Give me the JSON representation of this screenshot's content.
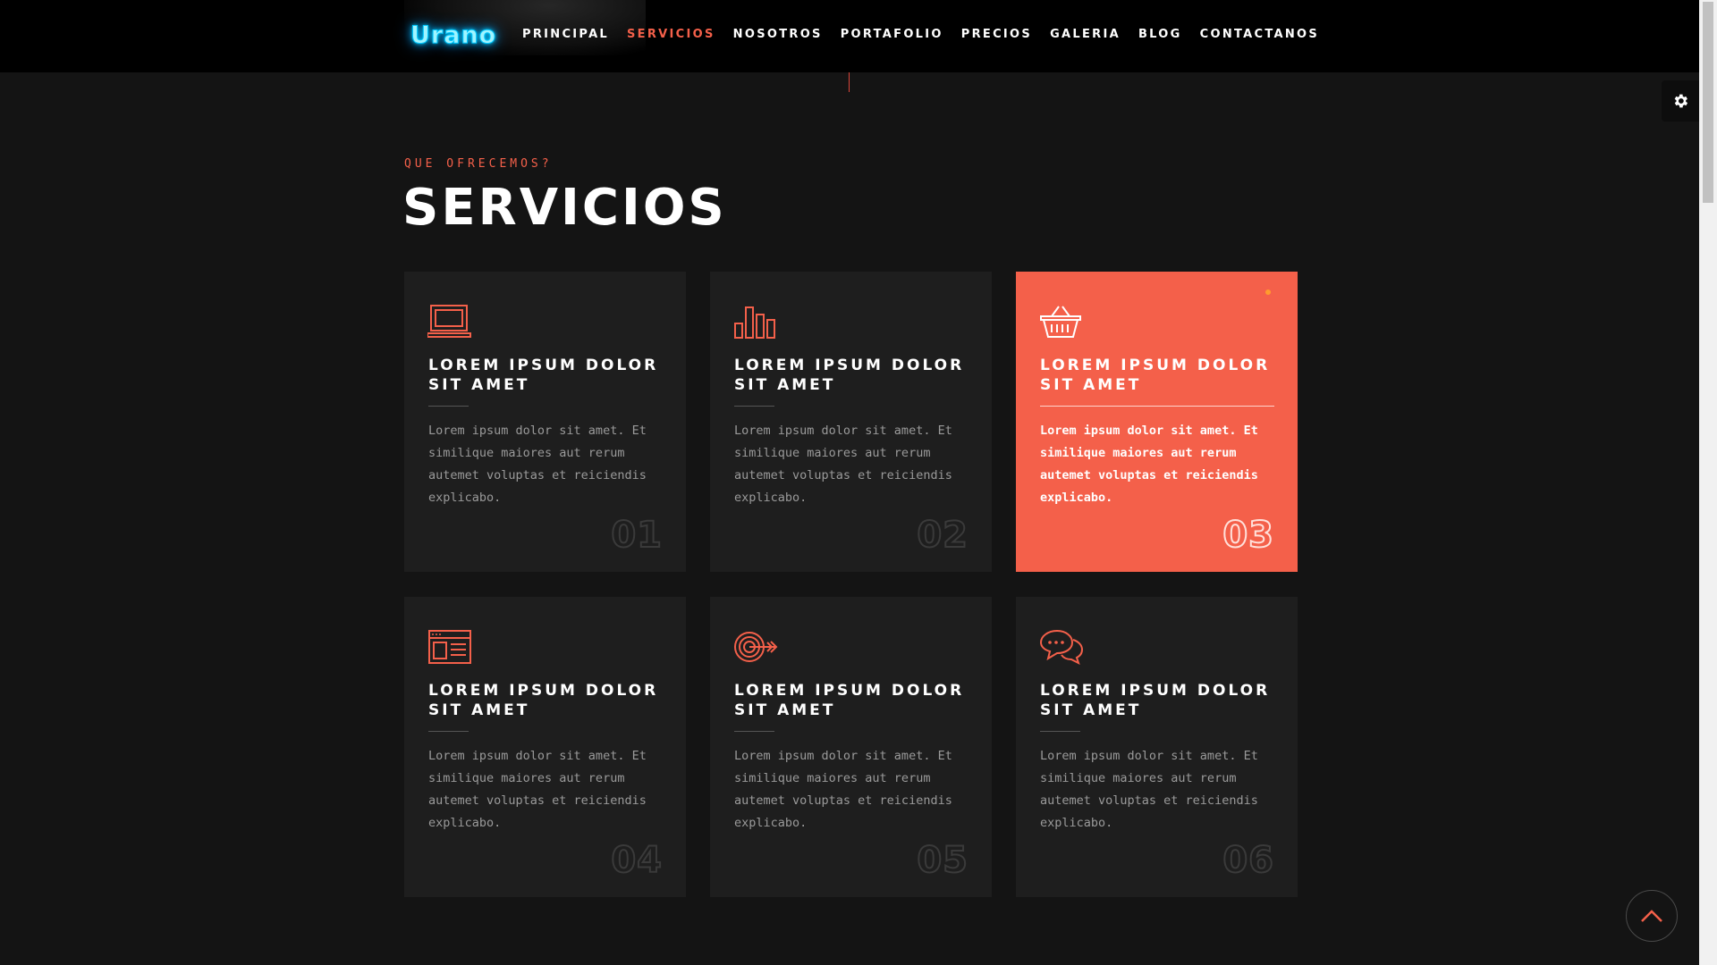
{
  "nav": {
    "logo": "Urano",
    "items": [
      {
        "label": "PRINCIPAL",
        "active": false
      },
      {
        "label": "SERVICIOS",
        "active": true
      },
      {
        "label": "NOSOTROS",
        "active": false
      },
      {
        "label": "PORTAFOLIO",
        "active": false
      },
      {
        "label": "PRECIOS",
        "active": false
      },
      {
        "label": "GALERIA",
        "active": false
      },
      {
        "label": "BLOG",
        "active": false
      },
      {
        "label": "CONTACTANOS",
        "active": false
      }
    ]
  },
  "section": {
    "subtitle": "QUE OFRECEMOS?",
    "title": "SERVICIOS"
  },
  "cards": [
    {
      "icon": "laptop-icon",
      "title": "LOREM IPSUM DOLOR SIT AMET",
      "text": "Lorem ipsum dolor sit amet. Et similique maiores aut rerum autemet voluptas et reiciendis explicabo.",
      "number": "01",
      "active": false
    },
    {
      "icon": "bar-chart-icon",
      "title": "LOREM IPSUM DOLOR SIT AMET",
      "text": "Lorem ipsum dolor sit amet. Et similique maiores aut rerum autemet voluptas et reiciendis explicabo.",
      "number": "02",
      "active": false
    },
    {
      "icon": "basket-icon",
      "title": "LOREM IPSUM DOLOR SIT AMET",
      "text": "Lorem ipsum dolor sit amet. Et similique maiores aut rerum autemet voluptas et reiciendis explicabo.",
      "number": "03",
      "active": true
    },
    {
      "icon": "browser-window-icon",
      "title": "LOREM IPSUM DOLOR SIT AMET",
      "text": "Lorem ipsum dolor sit amet. Et similique maiores aut rerum autemet voluptas et reiciendis explicabo.",
      "number": "04",
      "active": false
    },
    {
      "icon": "target-icon",
      "title": "LOREM IPSUM DOLOR SIT AMET",
      "text": "Lorem ipsum dolor sit amet. Et similique maiores aut rerum autemet voluptas et reiciendis explicabo.",
      "number": "05",
      "active": false
    },
    {
      "icon": "chat-bubbles-icon",
      "title": "LOREM IPSUM DOLOR SIT AMET",
      "text": "Lorem ipsum dolor sit amet. Et similique maiores aut rerum autemet voluptas et reiciendis explicabo.",
      "number": "06",
      "active": false
    }
  ],
  "colors": {
    "accent": "#f4604a",
    "background": "#141414",
    "card": "#1e1e1e",
    "logo_glow": "#00c8ff"
  }
}
